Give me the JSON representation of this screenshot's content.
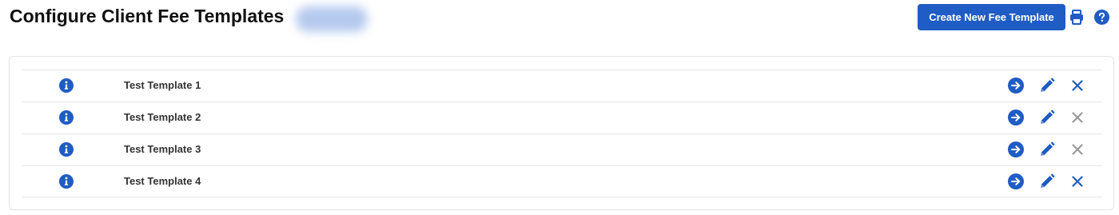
{
  "header": {
    "title": "Configure Client Fee Templates",
    "create_button_label": "Create New Fee Template"
  },
  "colors": {
    "primary": "#1f5cc4",
    "disabled": "#9a9a9a"
  },
  "icons": {
    "header": [
      "print-icon",
      "help-icon"
    ],
    "row": [
      "info-icon",
      "arrow-right-circle-icon",
      "pencil-icon",
      "close-icon"
    ]
  },
  "templates": [
    {
      "name": "Test Template 1",
      "delete_enabled": true
    },
    {
      "name": "Test Template 2",
      "delete_enabled": false
    },
    {
      "name": "Test Template 3",
      "delete_enabled": false
    },
    {
      "name": "Test Template 4",
      "delete_enabled": true
    }
  ]
}
